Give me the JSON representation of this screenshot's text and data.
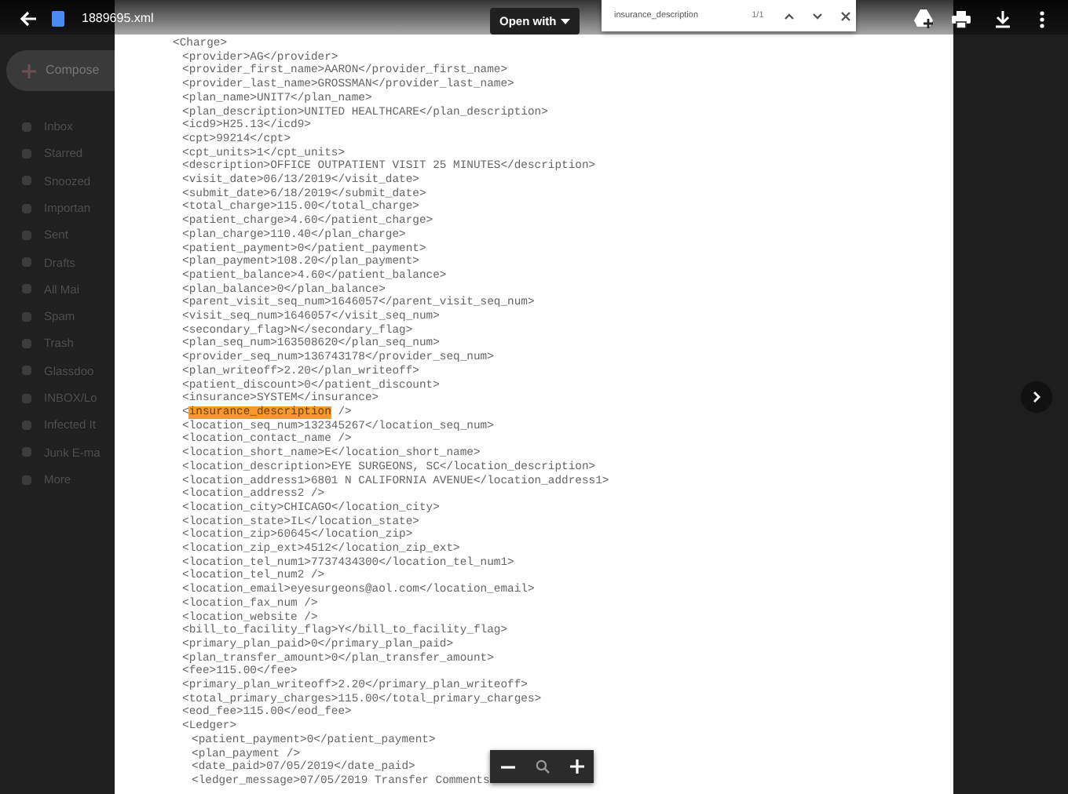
{
  "toolbar": {
    "file_name": "1889695.xml",
    "open_with": "Open with",
    "find": {
      "value": "insurance_description",
      "count": "1/1"
    }
  },
  "sidebar": {
    "compose": "Compose",
    "items": [
      {
        "label": "Inbox"
      },
      {
        "label": "Starred"
      },
      {
        "label": "Snoozed"
      },
      {
        "label": "Importan"
      },
      {
        "label": "Sent"
      },
      {
        "label": "Drafts"
      },
      {
        "label": "All Mai"
      },
      {
        "label": "Spam"
      },
      {
        "label": "Trash"
      },
      {
        "label": "Glassdoo"
      },
      {
        "label": "INBOX/Lo"
      },
      {
        "label": "Infected It"
      },
      {
        "label": "Junk E-ma"
      },
      {
        "label": "More"
      }
    ]
  },
  "document": {
    "lines": [
      {
        "text": "<Charge>",
        "children": [
          {
            "text": "<provider>AG</provider>"
          },
          {
            "text": "<provider_first_name>AARON</provider_first_name>"
          },
          {
            "text": "<provider_last_name>GROSSMAN</provider_last_name>"
          },
          {
            "text": "<plan_name>UNIT7</plan_name>"
          },
          {
            "text": "<plan_description>UNITED HEALTHCARE</plan_description>"
          },
          {
            "text": "<icd9>H25.13</icd9>"
          },
          {
            "text": "<cpt>99214</cpt>"
          },
          {
            "text": "<cpt_units>1</cpt_units>"
          },
          {
            "text": "<description>OFFICE OUTPATIENT VISIT 25 MINUTES</description>"
          },
          {
            "text": "<visit_date>06/13/2019</visit_date>"
          },
          {
            "text": "<submit_date>6/18/2019</submit_date>"
          },
          {
            "text": "<total_charge>115.00</total_charge>"
          },
          {
            "text": "<patient_charge>4.60</patient_charge>"
          },
          {
            "text": "<plan_charge>110.40</plan_charge>"
          },
          {
            "text": "<patient_payment>0</patient_payment>"
          },
          {
            "text": "<plan_payment>108.20</plan_payment>"
          },
          {
            "text": "<patient_balance>4.60</patient_balance>"
          },
          {
            "text": "<plan_balance>0</plan_balance>"
          },
          {
            "text": "<parent_visit_seq_num>1646057</parent_visit_seq_num>"
          },
          {
            "text": "<visit_seq_num>1646057</visit_seq_num>"
          },
          {
            "text": "<secondary_flag>N</secondary_flag>"
          },
          {
            "text": "<plan_seq_num>163508620</plan_seq_num>"
          },
          {
            "text": "<provider_seq_num>136743178</provider_seq_num>"
          },
          {
            "text": "<plan_writeoff>2.20</plan_writeoff>"
          },
          {
            "text": "<patient_discount>0</patient_discount>"
          },
          {
            "text": "<insurance>SYSTEM</insurance>"
          },
          {
            "kind": "match",
            "prefix": "<",
            "match": "insurance_description",
            "suffix": " />"
          },
          {
            "text": "<location_seq_num>132345267</location_seq_num>"
          },
          {
            "text": "<location_contact_name />"
          },
          {
            "text": "<location_short_name>E</location_short_name>"
          },
          {
            "text": "<location_description>EYE SURGEONS, SC</location_description>"
          },
          {
            "text": "<location_address1>6801 N CALIFORNIA AVENUE</location_address1>"
          },
          {
            "text": "<location_address2 />"
          },
          {
            "text": "<location_city>CHICAGO</location_city>"
          },
          {
            "text": "<location_state>IL</location_state>"
          },
          {
            "text": "<location_zip>60645</location_zip>"
          },
          {
            "text": "<location_zip_ext>4512</location_zip_ext>"
          },
          {
            "text": "<location_tel_num1>7737434300</location_tel_num1>"
          },
          {
            "text": "<location_tel_num2 />"
          },
          {
            "text": "<location_email>eyesurgeons@aol.com</location_email>"
          },
          {
            "text": "<location_fax_num />"
          },
          {
            "text": "<location_website />"
          },
          {
            "text": "<bill_to_facility_flag>Y</bill_to_facility_flag>"
          },
          {
            "text": "<primary_plan_paid>0</primary_plan_paid>"
          },
          {
            "text": "<plan_transfer_amount>0</plan_transfer_amount>"
          },
          {
            "text": "<fee>115.00</fee>"
          },
          {
            "text": "<primary_plan_writeoff>2.20</primary_plan_writeoff>"
          },
          {
            "text": "<total_primary_charges>115.00</total_primary_charges>"
          },
          {
            "text": "<eod_fee>115.00</eod_fee>"
          },
          {
            "text": "<Ledger>",
            "children": [
              {
                "text": "<patient_payment>0</patient_payment>"
              },
              {
                "text": "<plan_payment />"
              },
              {
                "text": "<date_paid>07/05/2019</date_paid>"
              },
              {
                "text": "<ledger_message>07/05/2019 Transfer Comments"
              }
            ]
          }
        ]
      }
    ]
  }
}
